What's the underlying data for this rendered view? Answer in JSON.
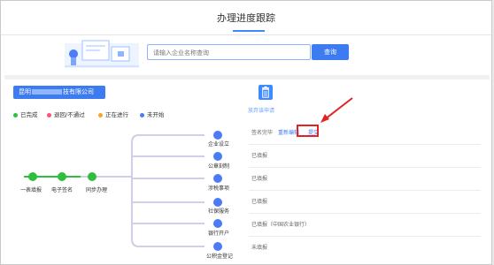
{
  "header": {
    "title": "办理进度跟踪"
  },
  "search": {
    "placeholder": "请输入企业名称查询",
    "button_label": "查询"
  },
  "company": {
    "name_prefix": "昆明",
    "name_suffix": "技有限公司"
  },
  "legend": [
    {
      "label": "已完成",
      "color": "#2fbf3c"
    },
    {
      "label": "退回/不通过",
      "color": "#ff4f7a"
    },
    {
      "label": "正在进行",
      "color": "#f5a623"
    },
    {
      "label": "未开始",
      "color": "#4a7df5"
    }
  ],
  "main_flow": [
    "一表填报",
    "电子签名",
    "同步办理"
  ],
  "branches": [
    "企业设立",
    "公章刻制",
    "涉税事项",
    "社保服务",
    "银行开户",
    "公积金登记"
  ],
  "delete_application_label": "放弃该申请",
  "status_rows": [
    {
      "text": "签名完毕",
      "actions": [
        "重新编辑",
        "提交"
      ]
    },
    {
      "text": "已填报"
    },
    {
      "text": "已填报"
    },
    {
      "text": "已填报"
    },
    {
      "text": "已填报（中国农业银行）"
    },
    {
      "text": "未填报"
    }
  ],
  "icons": {
    "delete": "trash-icon"
  },
  "colors": {
    "primary": "#3d7cf0",
    "done": "#2fbf3c",
    "pending_line": "#c9c9f0",
    "highlight": "#e02424"
  }
}
